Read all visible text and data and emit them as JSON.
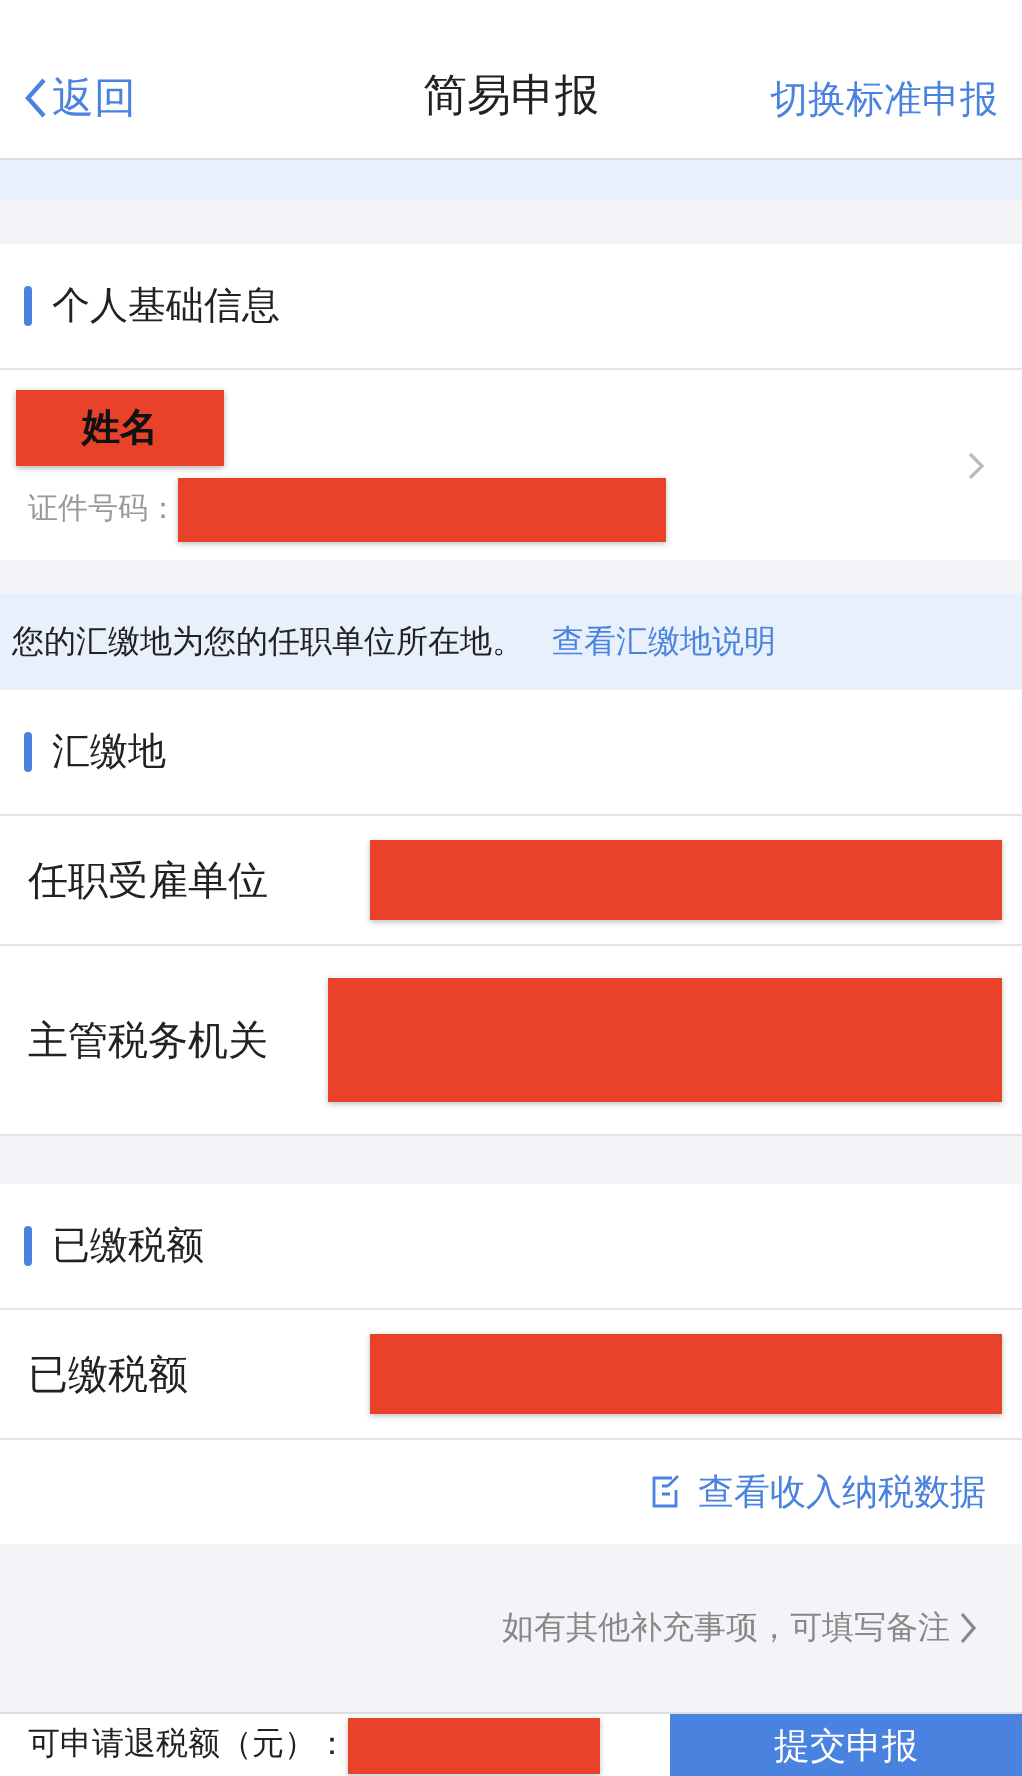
{
  "nav": {
    "back": "返回",
    "title": "简易申报",
    "action": "切换标准申报"
  },
  "personal": {
    "title": "个人基础信息",
    "name": "姓名",
    "id_label": "证件号码："
  },
  "notice": {
    "text": "您的汇缴地为您的任职单位所在地。",
    "link": "查看汇缴地说明"
  },
  "location": {
    "title": "汇缴地",
    "rows": [
      {
        "label": "任职受雇单位",
        "kind": "short"
      },
      {
        "label": "主管税务机关",
        "kind": "tall"
      }
    ]
  },
  "paid": {
    "title": "已缴税额",
    "rows": [
      {
        "label": "已缴税额",
        "kind": "short"
      }
    ],
    "link": "查看收入纳税数据"
  },
  "remark": "如有其他补充事项，可填写备注",
  "footer": {
    "label": "可申请退税额（元）：",
    "button": "提交申报"
  }
}
